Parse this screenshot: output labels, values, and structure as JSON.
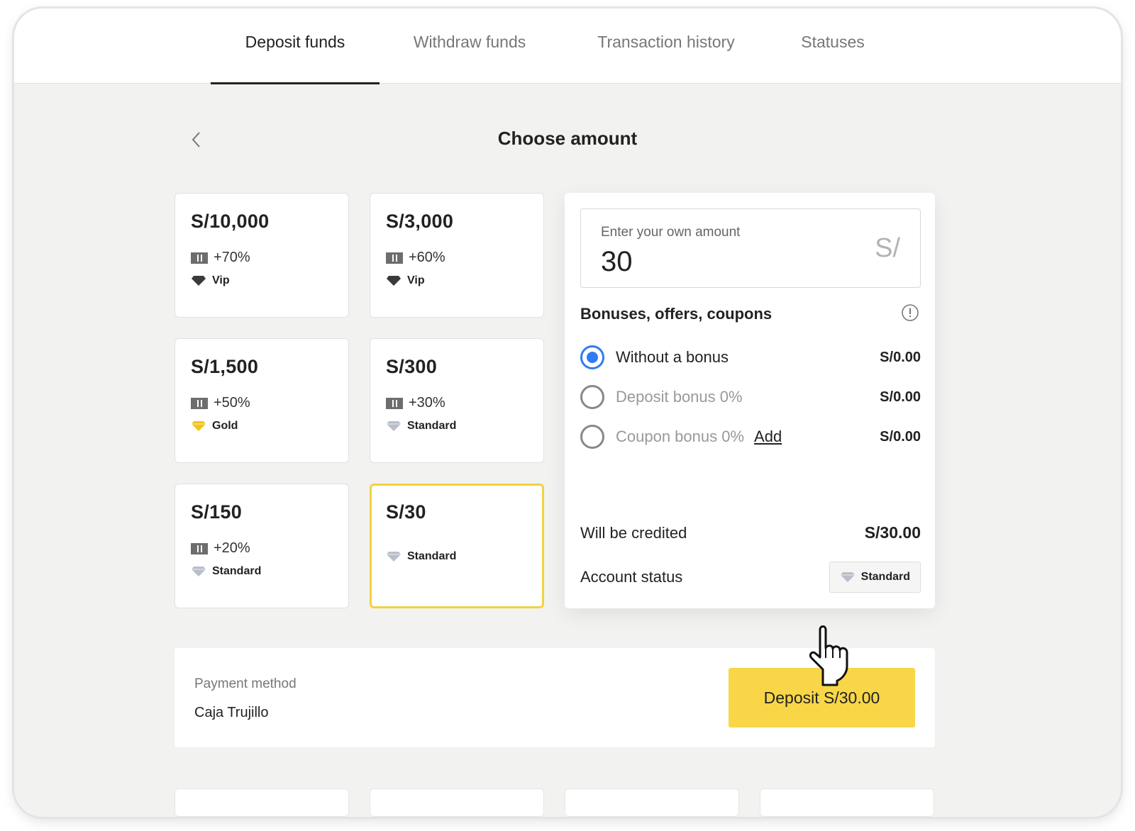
{
  "tabs": [
    {
      "label": "Deposit funds",
      "active": true
    },
    {
      "label": "Withdraw funds",
      "active": false
    },
    {
      "label": "Transaction history",
      "active": false
    },
    {
      "label": "Statuses",
      "active": false
    }
  ],
  "page": {
    "title": "Choose amount",
    "back_icon": "chevron-left-icon"
  },
  "amount_cards": [
    {
      "amount": "S/10,000",
      "bonus": "+70%",
      "status": "Vip"
    },
    {
      "amount": "S/3,000",
      "bonus": "+60%",
      "status": "Vip"
    },
    {
      "amount": "S/1,500",
      "bonus": "+50%",
      "status": "Gold"
    },
    {
      "amount": "S/300",
      "bonus": "+30%",
      "status": "Standard"
    },
    {
      "amount": "S/150",
      "bonus": "+20%",
      "status": "Standard"
    },
    {
      "amount": "S/30",
      "status": "Standard",
      "selected": true
    }
  ],
  "amount_input": {
    "label": "Enter your own amount",
    "value": "30",
    "currency": "S/"
  },
  "bonuses": {
    "title": "Bonuses, offers, coupons",
    "options": [
      {
        "label": "Without a bonus",
        "value": "S/0.00",
        "selected": true
      },
      {
        "label": "Deposit bonus 0%",
        "value": "S/0.00",
        "selected": false
      },
      {
        "label": "Coupon bonus 0%",
        "add_label": "Add",
        "value": "S/0.00",
        "selected": false
      }
    ]
  },
  "summary": {
    "credited_label": "Will be credited",
    "credited_value": "S/30.00",
    "status_label": "Account status",
    "status_value": "Standard"
  },
  "payment": {
    "method_label": "Payment method",
    "method_value": "Caja Trujillo",
    "deposit_button": "Deposit S/30.00"
  },
  "colors": {
    "accent_yellow": "#f8d648",
    "selected_border": "#f3d23f",
    "radio_blue": "#2f7bf5",
    "gold_diamond": "#f0c419",
    "standard_diamond": "#b9bfc9",
    "vip_diamond": "#3a3a3a"
  }
}
